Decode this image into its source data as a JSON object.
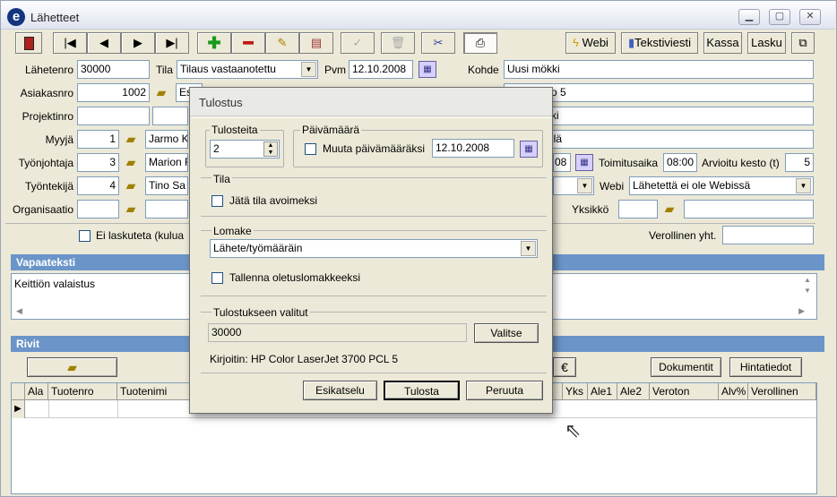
{
  "window": {
    "title": "Lähetteet",
    "app_icon": "e"
  },
  "toolbar": {
    "webi": "Webi",
    "tekstiviesti": "Tekstiviesti",
    "kassa": "Kassa",
    "lasku": "Lasku"
  },
  "form": {
    "lahetenro_label": "Lähetenro",
    "lahetenro": "30000",
    "tila_label": "Tila",
    "tila": "Tilaus vastaanotettu",
    "pvm_label": "Pvm",
    "pvm": "12.10.2008",
    "kohde_label": "Kohde",
    "kohde": "Uusi mökki",
    "asiakasnro_label": "Asiakasnro",
    "asiakasnro": "1002",
    "asiakas_name": "Es",
    "osoite": "o 5",
    "projektinro_label": "Projektinro",
    "row3_right": "ki",
    "myyja_label": "Myyjä",
    "myyja_nro": "1",
    "myyja_name": "Jarmo K",
    "row4_right": "ilä",
    "tyonjohtaja_label": "Työnjohtaja",
    "tyonjohtaja_nro": "3",
    "tyonjohtaja_name": "Marion R",
    "row5_date": "08",
    "toimitusaika_label": "Toimitusaika",
    "toimitusaika": "08:00",
    "arvioitu_label": "Arvioitu kesto (t)",
    "arvioitu": "5",
    "tyontekija_label": "Työntekijä",
    "tyontekija_nro": "4",
    "tyontekija_name": "Tino Sa",
    "webi_label": "Webi",
    "webi_status": "Lähetettä ei ole Webissä",
    "organisaatio_label": "Organisaatio",
    "yksikko_label": "Yksikkö",
    "ei_laskuteta": "Ei laskuteta (kulua",
    "verollinen_yht": "Verollinen yht."
  },
  "vapaateksti": {
    "title": "Vapaateksti",
    "text": "Keittiön valaistus"
  },
  "rivit": {
    "title": "Rivit",
    "euro": "€",
    "dokumentit": "Dokumentit",
    "hintatiedot": "Hintatiedot",
    "columns": [
      "Ala",
      "Tuotenro",
      "Tuotenimi",
      "Yks",
      "Ale1",
      "Ale2",
      "Veroton",
      "Alv%",
      "Verollinen"
    ]
  },
  "dialog": {
    "title": "Tulostus",
    "tulosteita_label": "Tulosteita",
    "tulosteita": "2",
    "paivamaara_label": "Päivämäärä",
    "muuta_label": "Muuta päivämääräksi",
    "muuta_date": "12.10.2008",
    "tila_label": "Tila",
    "jata_label": "Jätä tila avoimeksi",
    "lomake_label": "Lomake",
    "lomake": "Lähete/työmääräin",
    "tallenna_label": "Tallenna oletuslomakkeeksi",
    "valitut_label": "Tulostukseen valitut",
    "valitut": "30000",
    "valitse": "Valitse",
    "kirjoitin": "Kirjoitin: HP Color LaserJet 3700 PCL 5",
    "esikatselu": "Esikatselu",
    "tulosta": "Tulosta",
    "peruuta": "Peruuta"
  }
}
